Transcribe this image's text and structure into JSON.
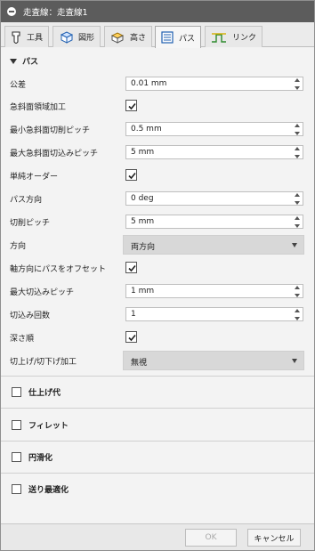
{
  "window": {
    "title": "走査線：走査線1"
  },
  "tabs": [
    {
      "label": "工具",
      "icon": "tool-icon"
    },
    {
      "label": "図形",
      "icon": "geometry-icon"
    },
    {
      "label": "高さ",
      "icon": "heights-icon"
    },
    {
      "label": "パス",
      "icon": "passes-icon",
      "active": true
    },
    {
      "label": "リンク",
      "icon": "linking-icon"
    }
  ],
  "section": {
    "title": "パス"
  },
  "fields": {
    "tolerance": {
      "label": "公差",
      "value": "0.01 mm"
    },
    "steep_machining": {
      "label": "急斜面領域加工",
      "checked": true
    },
    "min_steep_stepover": {
      "label": "最小急斜面切削ピッチ",
      "value": "0.5 mm"
    },
    "max_steep_stepdown": {
      "label": "最大急斜面切込みピッチ",
      "value": "5 mm"
    },
    "one_way": {
      "label": "単純オーダー",
      "checked": true
    },
    "pass_direction": {
      "label": "パス方向",
      "value": "0 deg"
    },
    "stepover": {
      "label": "切削ピッチ",
      "value": "5 mm"
    },
    "direction": {
      "label": "方向",
      "value": "両方向"
    },
    "axial_offset": {
      "label": "軸方向にパスをオフセット",
      "checked": true
    },
    "max_stepdown": {
      "label": "最大切込みピッチ",
      "value": "1 mm"
    },
    "stepdowns": {
      "label": "切込み回数",
      "value": "1"
    },
    "depth_first": {
      "label": "深さ順",
      "checked": true
    },
    "ramp_type": {
      "label": "切上げ/切下げ加工",
      "value": "無視"
    }
  },
  "groups": [
    {
      "label": "仕上げ代"
    },
    {
      "label": "フィレット"
    },
    {
      "label": "円滑化"
    },
    {
      "label": "送り最適化"
    }
  ],
  "footer": {
    "ok": "OK",
    "cancel": "キャンセル"
  }
}
